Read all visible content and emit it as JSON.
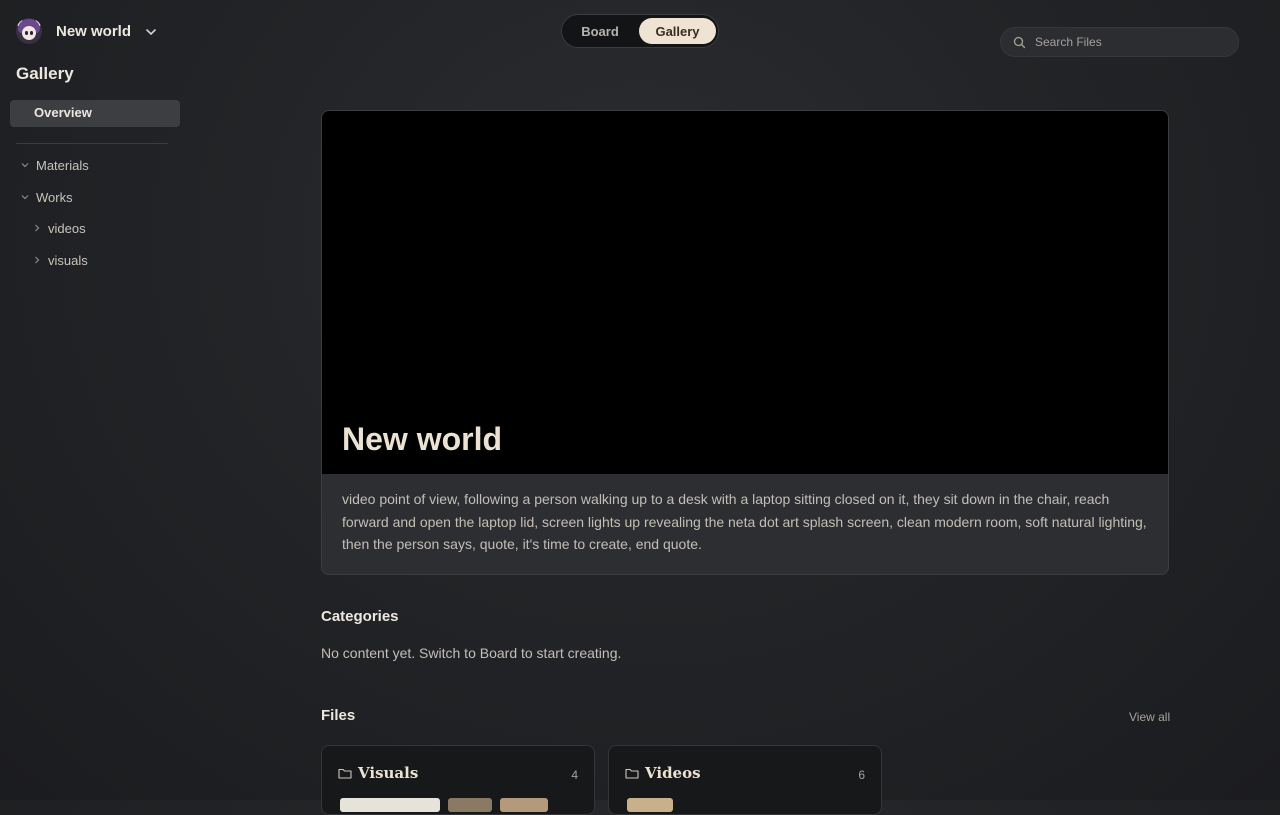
{
  "workspace": {
    "name": "New world"
  },
  "sidebar": {
    "title": "Gallery",
    "overview_label": "Overview",
    "tree": [
      {
        "label": "Materials",
        "expanded": true,
        "level": 0
      },
      {
        "label": "Works",
        "expanded": true,
        "level": 0
      },
      {
        "label": "videos",
        "expanded": false,
        "level": 1
      },
      {
        "label": "visuals",
        "expanded": false,
        "level": 1
      }
    ]
  },
  "view_switch": {
    "board_label": "Board",
    "gallery_label": "Gallery",
    "active": "Gallery"
  },
  "search": {
    "placeholder": "Search Files"
  },
  "hero": {
    "title": "New world",
    "description": "video point of view, following a person walking up to a desk with a laptop sitting closed on it, they sit down in the chair, reach forward and open the laptop lid, screen lights up revealing the neta dot art splash screen, clean modern room, soft natural lighting, then the person says, quote, it's time to create, end quote."
  },
  "categories": {
    "title": "Categories",
    "empty_message": "No content yet. Switch to Board to start creating."
  },
  "files": {
    "title": "Files",
    "view_all_label": "View all",
    "folders": [
      {
        "name": "Visuals",
        "count": "4"
      },
      {
        "name": "Videos",
        "count": "6"
      }
    ]
  },
  "colors": {
    "background": "#222427",
    "accent": "#efe3d3",
    "panel": "#2c2e31"
  }
}
